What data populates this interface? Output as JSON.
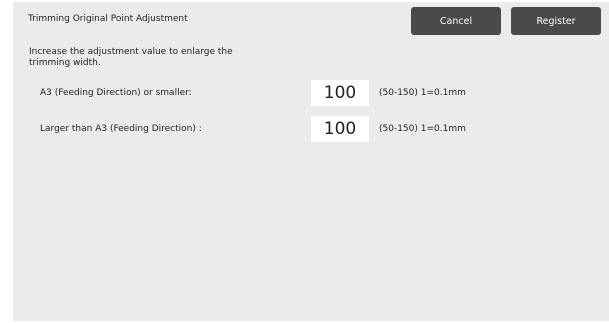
{
  "header": {
    "title": "Trimming Original Point Adjustment",
    "cancel_label": "Cancel",
    "register_label": "Register"
  },
  "instruction": "Increase the adjustment value to enlarge the trimming width.",
  "settings": [
    {
      "label": "A3 (Feeding Direction) or smaller:",
      "value": "100",
      "range": "(50-150) 1=0.1mm"
    },
    {
      "label": "Larger than A3 (Feeding Direction) :",
      "value": "100",
      "range": "(50-150) 1=0.1mm"
    }
  ],
  "colors": {
    "panel_background": "#ebebeb",
    "button_background": "#4a4a4a",
    "button_text": "#ffffff",
    "value_box_background": "#ffffff"
  }
}
